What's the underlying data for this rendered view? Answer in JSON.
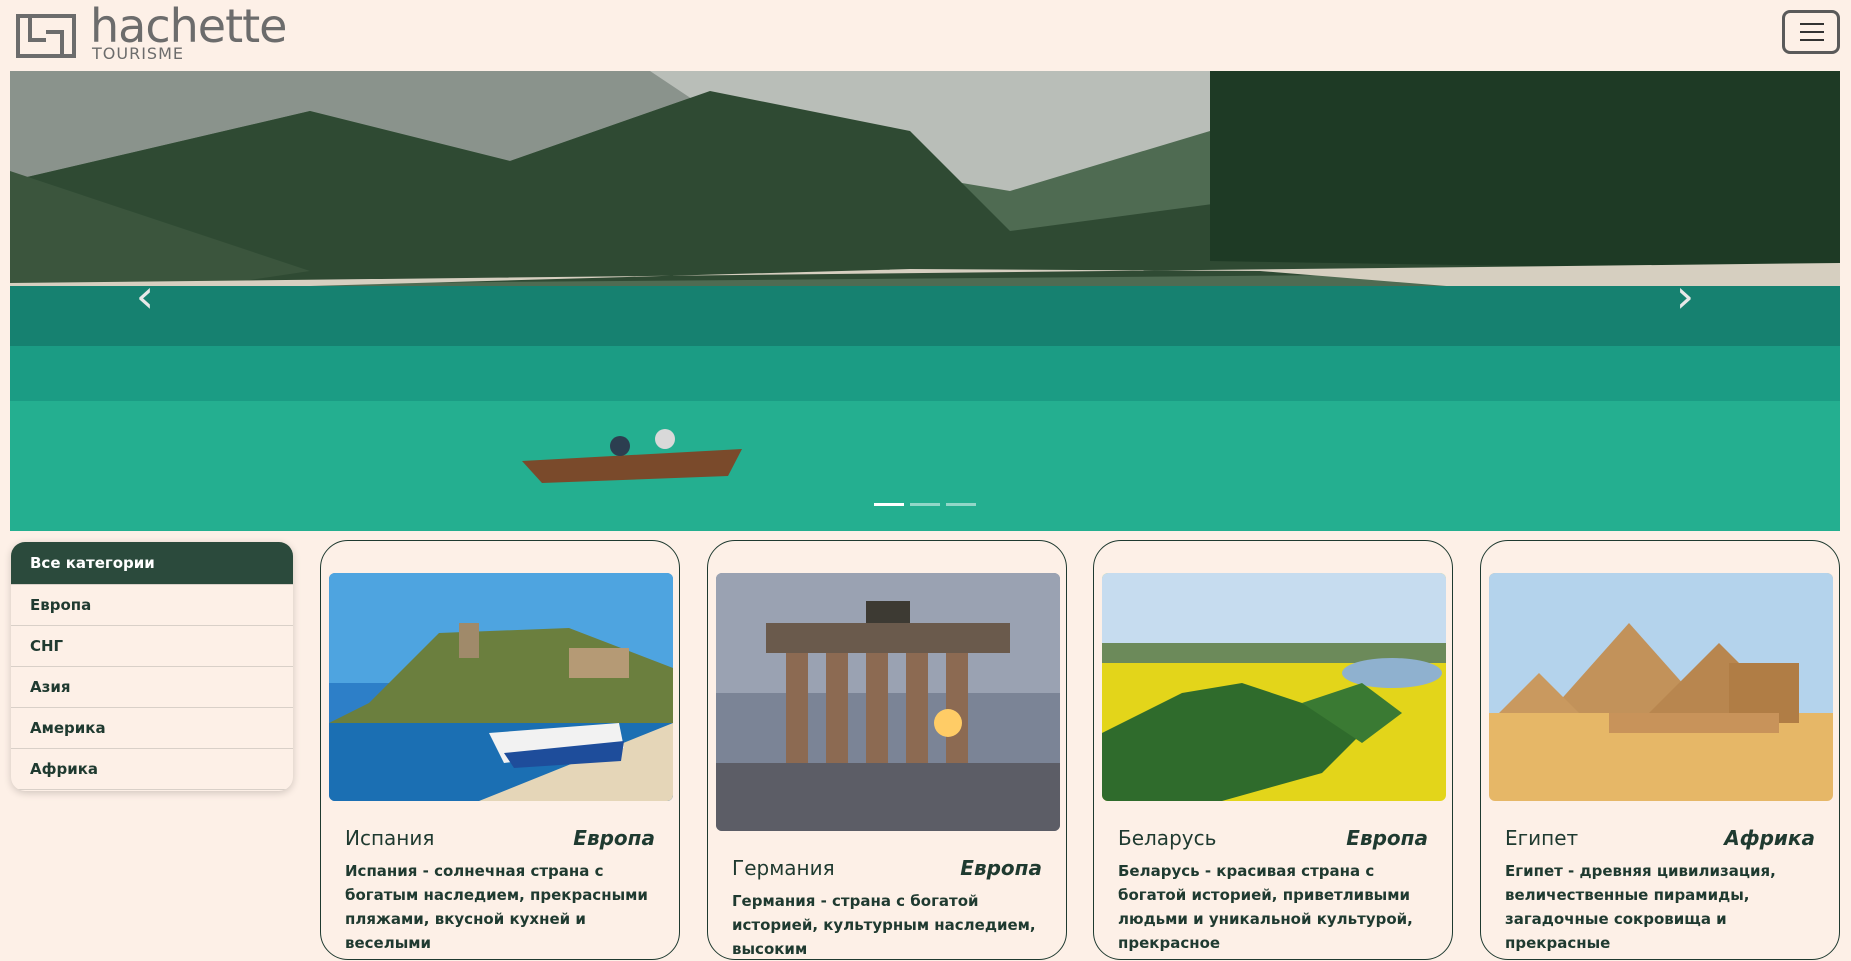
{
  "header": {
    "logo_main": "hachette",
    "logo_sub": "TOURISME"
  },
  "hero": {
    "prev": "‹",
    "next": "›",
    "slides": 3,
    "active_slide": 1
  },
  "categories": [
    {
      "label": "Все категории",
      "active": true
    },
    {
      "label": "Европа"
    },
    {
      "label": "СНГ"
    },
    {
      "label": "Азия"
    },
    {
      "label": "Америка"
    },
    {
      "label": "Африка"
    }
  ],
  "cards": [
    {
      "title": "Испания",
      "region": "Европа",
      "desc": "Испания - солнечная страна с богатым наследием, прекрасными пляжами, вкусной кухней и веселыми"
    },
    {
      "title": "Германия",
      "region": "Европа",
      "desc": "Германия - страна с богатой историей, культурным наследием, высоким"
    },
    {
      "title": "Беларусь",
      "region": "Европа",
      "desc": "Беларусь - красивая страна с богатой историей, приветливыми людьми и уникальной культурой, прекрасное"
    },
    {
      "title": "Египет",
      "region": "Африка",
      "desc": "Египет - древняя цивилизация, величественные пирамиды, загадочные сокровища и прекрасные"
    }
  ]
}
